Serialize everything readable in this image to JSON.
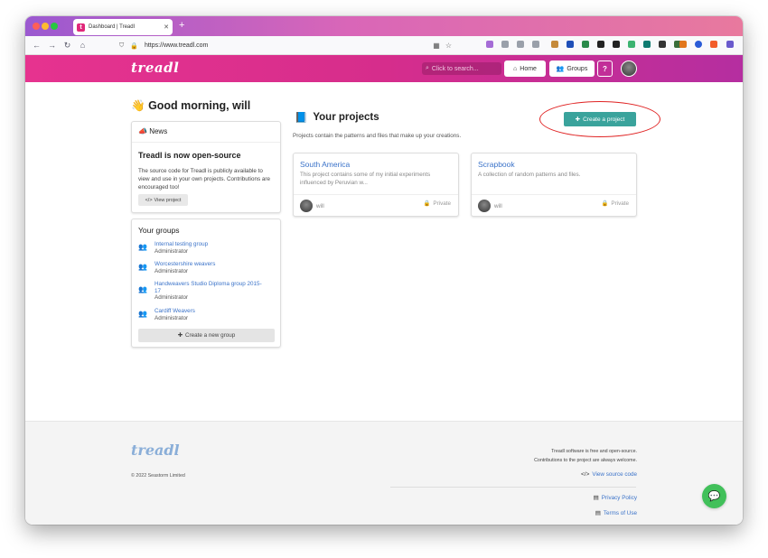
{
  "browser": {
    "tab_title": "Dashboard | Treadl",
    "tab_favicon": "t",
    "new_tab": "+",
    "url": "https://www.treadl.com"
  },
  "header": {
    "logo": "treadl",
    "search_placeholder": "Click to search...",
    "home_label": "Home",
    "groups_label": "Groups",
    "help_label": "?"
  },
  "greeting": {
    "emoji": "👋",
    "text": "Good morning, will"
  },
  "news": {
    "heading": "News",
    "title": "Treadl is now open-source",
    "body": "The source code for Treadl is publicly available to view and use in your own projects. Contributions are encouraged too!",
    "button_label": "View project"
  },
  "groups": {
    "heading": "Your groups",
    "items": [
      {
        "name": "Internal testing group",
        "role": "Administrator"
      },
      {
        "name": "Worcestershire weavers",
        "role": "Administrator"
      },
      {
        "name": "Handweavers Studio Diploma group 2015-17",
        "role": "Administrator"
      },
      {
        "name": "Cardiff Weavers",
        "role": "Administrator"
      }
    ],
    "create_label": "Create a new group"
  },
  "projects": {
    "heading": "Your projects",
    "subtitle": "Projects contain the patterns and files that make up your creations.",
    "create_label": "Create a project",
    "items": [
      {
        "title": "South America",
        "description": "This project contains some of my initial experiments influenced by Peruvian w...",
        "owner": "will",
        "visibility": "Private"
      },
      {
        "title": "Scrapbook",
        "description": "A collection of random patterns and files.",
        "owner": "will",
        "visibility": "Private"
      }
    ]
  },
  "footer": {
    "logo": "treadl",
    "copyright": "© 2022 Seastorm Limited",
    "line1": "Treadl software is free and open-source.",
    "line2": "Contributions to the project are always welcome.",
    "source_link": "View source code",
    "privacy_link": "Privacy Policy",
    "terms_link": "Terms of Use"
  },
  "colors": {
    "brand_pink": "#e6338f",
    "accent_teal": "#3aa39c",
    "link_blue": "#3b73c9",
    "chat_green": "#41c05a",
    "highlight_red": "#e02424"
  }
}
